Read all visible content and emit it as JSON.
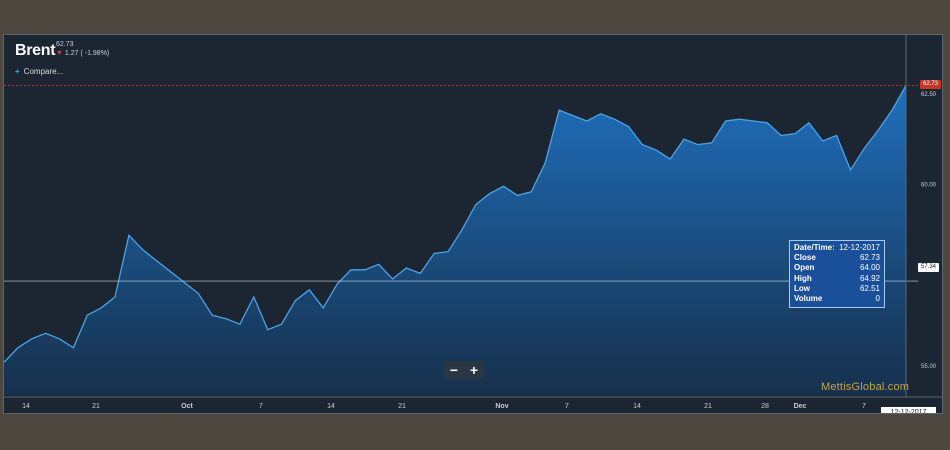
{
  "header": {
    "symbol": "Brent",
    "last_price": "62.73",
    "change_arrow": "▼",
    "change": "1.27 ( -1.98%)",
    "compare_icon": "plus-icon",
    "compare_label": "Compare..."
  },
  "zoom": {
    "out_label": "−",
    "in_label": "+"
  },
  "tooltip": {
    "rows": [
      {
        "label": "Date/Time:",
        "value": "12-12-2017"
      },
      {
        "label": "Close",
        "value": "62.73"
      },
      {
        "label": "Open",
        "value": "64.00"
      },
      {
        "label": "High",
        "value": "64.92"
      },
      {
        "label": "Low",
        "value": "62.51"
      },
      {
        "label": "Volume",
        "value": "0"
      }
    ]
  },
  "watermark": "MettisGlobal.com",
  "price_badges": {
    "last": "62.73",
    "hover": "57.34"
  },
  "colors": {
    "background": "#1c2633",
    "line": "#4aa3e8",
    "area_top": "#1f73c4",
    "area_bottom": "#16324f",
    "last_price": "#c0392b"
  },
  "chart_data": {
    "type": "area",
    "title": "Brent",
    "xlabel": "",
    "ylabel": "",
    "ylim": [
      54.2,
      63.9
    ],
    "y_ticks": [
      "55.00",
      "60.00",
      "62.50"
    ],
    "x_ticks": [
      "14",
      "21",
      "Oct",
      "7",
      "14",
      "21",
      "Nov",
      "7",
      "14",
      "21",
      "28",
      "Dec",
      "7"
    ],
    "x_selected": "12-12-2017",
    "last_price_line": 62.73,
    "crosshair_price": 57.34,
    "grid": false,
    "legend": "none",
    "series": [
      {
        "values": [
          55.1,
          55.5,
          55.75,
          55.9,
          55.75,
          55.5,
          56.4,
          56.6,
          56.9,
          58.6,
          58.2,
          57.9,
          57.6,
          57.3,
          57.0,
          56.4,
          56.3,
          56.15,
          56.9,
          56.0,
          56.15,
          56.8,
          57.1,
          56.6,
          57.25,
          57.65,
          57.65,
          57.8,
          57.4,
          57.7,
          57.55,
          58.1,
          58.15,
          58.75,
          59.45,
          59.75,
          59.95,
          59.7,
          59.8,
          60.6,
          62.05,
          61.9,
          61.75,
          61.95,
          61.8,
          61.6,
          61.1,
          60.95,
          60.7,
          61.25,
          61.1,
          61.15,
          61.75,
          61.8,
          61.75,
          61.7,
          61.35,
          61.4,
          61.7,
          61.2,
          61.35,
          60.4,
          61.0,
          61.5,
          62.05,
          62.73
        ]
      }
    ]
  }
}
